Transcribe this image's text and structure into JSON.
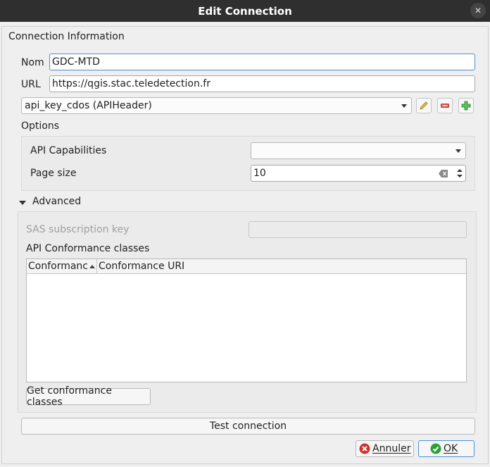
{
  "window": {
    "title": "Edit Connection",
    "close_glyph": "✕"
  },
  "connection": {
    "group_title": "Connection Information",
    "name_label": "Nom",
    "name_value": "GDC-MTD",
    "url_label": "URL",
    "url_value": "https://qgis.stac.teledetection.fr",
    "auth_value": "api_key_cdos (APIHeader)"
  },
  "options": {
    "title": "Options",
    "api_capabilities_label": "API Capabilities",
    "api_capabilities_value": "",
    "page_size_label": "Page size",
    "page_size_value": "10"
  },
  "advanced": {
    "title": "Advanced",
    "sas_key_label": "SAS subscription key",
    "sas_key_value": "",
    "conformance_title": "API Conformance classes",
    "columns": [
      "Conformanc",
      "Conformance URI"
    ],
    "get_button": "Get conformance classes"
  },
  "footer": {
    "test_button": "Test connection",
    "cancel_button": "Annuler",
    "ok_button": "OK"
  },
  "colors": {
    "titlebar": "#2f2f2f",
    "cancel_icon": "#d0312d",
    "ok_icon": "#2e9e3a",
    "focus_border": "#4a90d9"
  }
}
